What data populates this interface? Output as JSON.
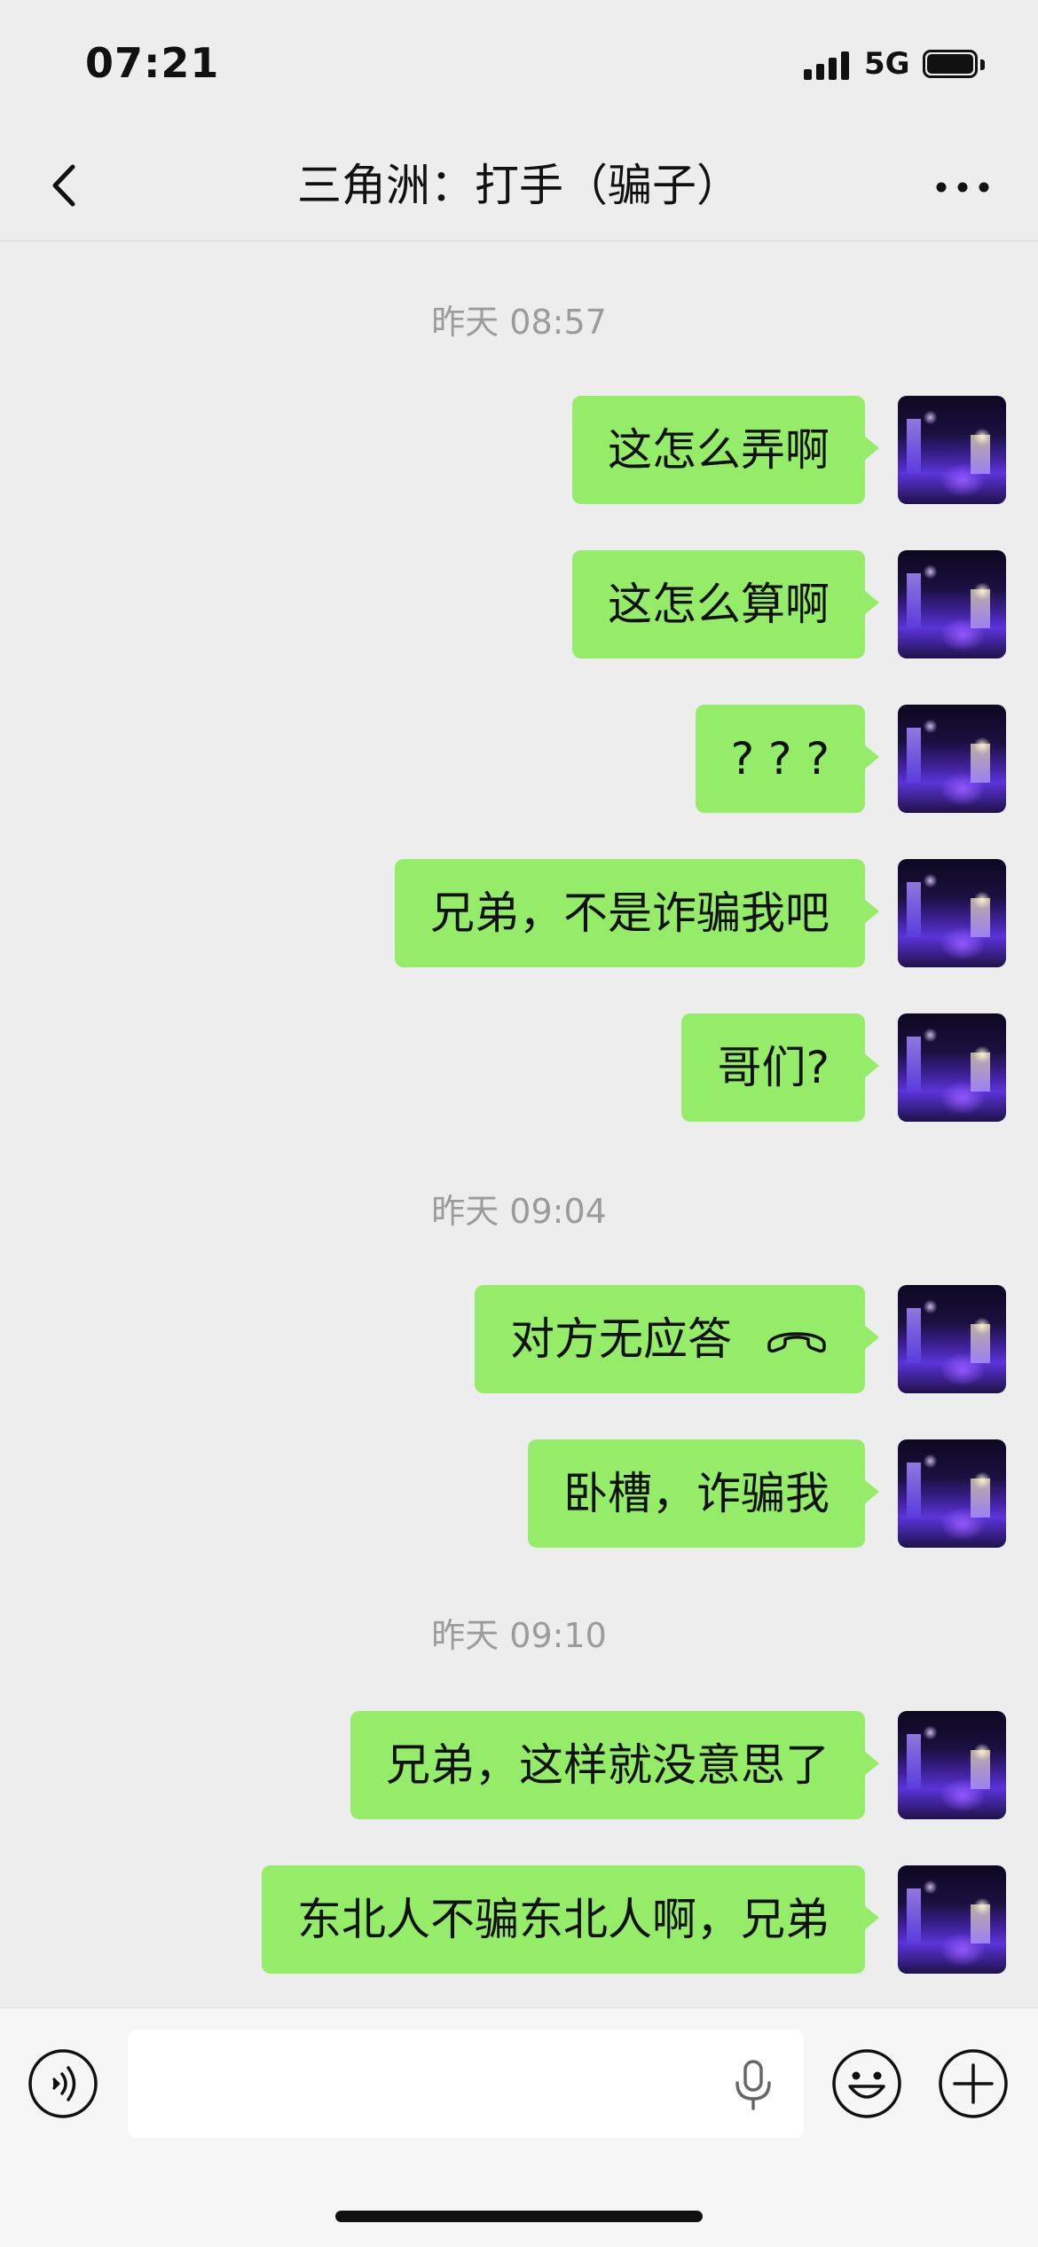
{
  "status_bar": {
    "time": "07:21",
    "network": "5G"
  },
  "nav": {
    "title": "三角洲：打手（骗子）"
  },
  "chat": {
    "timestamps": [
      "昨天 08:57",
      "昨天 09:04",
      "昨天 09:10"
    ],
    "messages": [
      "这怎么弄啊",
      "这怎么算啊",
      "? ? ?",
      "兄弟，不是诈骗我吧",
      "哥们?",
      "对方无应答",
      "卧槽，诈骗我",
      "兄弟，这样就没意思了",
      "东北人不骗东北人啊，兄弟"
    ]
  },
  "input": {
    "value": ""
  },
  "icons": {
    "back": "chevron-left-icon",
    "more": "more-dots-icon",
    "voice": "voice-icon",
    "mic": "microphone-icon",
    "emoji": "emoji-icon",
    "plus": "plus-icon",
    "hangup": "hang-up-phone-icon"
  },
  "colors": {
    "bubble": "#95ec69",
    "background": "#ededed",
    "timestamp": "#9b9b9b"
  }
}
